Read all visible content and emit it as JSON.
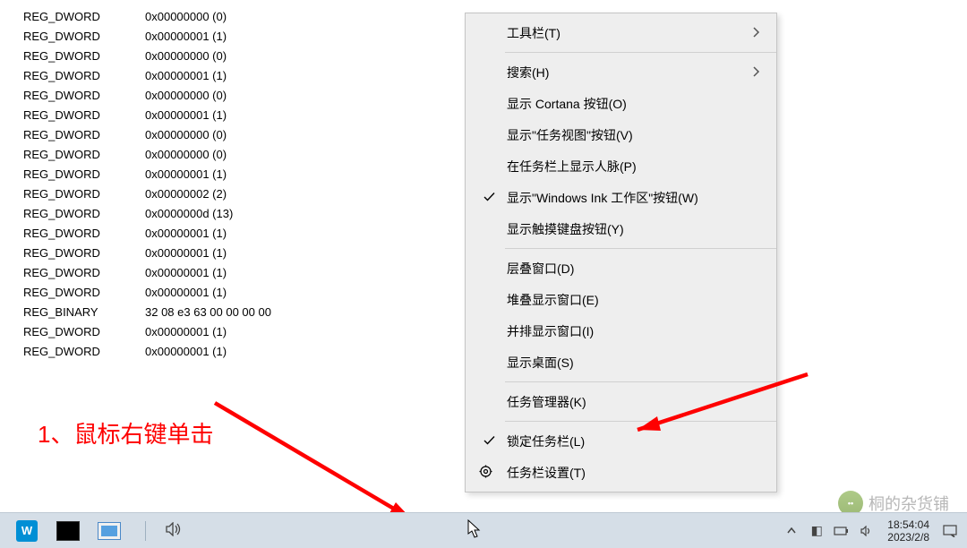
{
  "registry": {
    "rows": [
      {
        "type": "REG_DWORD",
        "value": "0x00000000 (0)"
      },
      {
        "type": "REG_DWORD",
        "value": "0x00000001 (1)"
      },
      {
        "type": "REG_DWORD",
        "value": "0x00000000 (0)"
      },
      {
        "type": "REG_DWORD",
        "value": "0x00000001 (1)"
      },
      {
        "type": "REG_DWORD",
        "value": "0x00000000 (0)"
      },
      {
        "type": "REG_DWORD",
        "value": "0x00000001 (1)"
      },
      {
        "type": "REG_DWORD",
        "value": "0x00000000 (0)"
      },
      {
        "type": "REG_DWORD",
        "value": "0x00000000 (0)"
      },
      {
        "type": "REG_DWORD",
        "value": "0x00000001 (1)"
      },
      {
        "type": "REG_DWORD",
        "value": "0x00000002 (2)"
      },
      {
        "type": "REG_DWORD",
        "value": "0x0000000d (13)"
      },
      {
        "type": "REG_DWORD",
        "value": "0x00000001 (1)"
      },
      {
        "type": "REG_DWORD",
        "value": "0x00000001 (1)"
      },
      {
        "type": "REG_DWORD",
        "value": "0x00000001 (1)"
      },
      {
        "type": "REG_DWORD",
        "value": "0x00000001 (1)"
      },
      {
        "type": "REG_BINARY",
        "value": "32 08 e3 63 00 00 00 00"
      },
      {
        "type": "REG_DWORD",
        "value": "0x00000001 (1)"
      },
      {
        "type": "REG_DWORD",
        "value": "0x00000001 (1)"
      }
    ]
  },
  "annotation": {
    "step1": "1、鼠标右键单击"
  },
  "menu": {
    "toolbar": "工具栏(T)",
    "search": "搜索(H)",
    "show_cortana": "显示 Cortana 按钮(O)",
    "show_taskview": "显示\"任务视图\"按钮(V)",
    "show_people": "在任务栏上显示人脉(P)",
    "show_ink": "显示\"Windows Ink 工作区\"按钮(W)",
    "show_keyboard": "显示触摸键盘按钮(Y)",
    "cascade": "层叠窗口(D)",
    "stacked": "堆叠显示窗口(E)",
    "sidebyside": "并排显示窗口(I)",
    "show_desktop": "显示桌面(S)",
    "task_manager": "任务管理器(K)",
    "lock_taskbar": "锁定任务栏(L)",
    "taskbar_settings": "任务栏设置(T)"
  },
  "clock": {
    "time": "18:54:04",
    "date": "2023/2/8"
  },
  "watermark": {
    "text": "桐的杂货铺"
  }
}
